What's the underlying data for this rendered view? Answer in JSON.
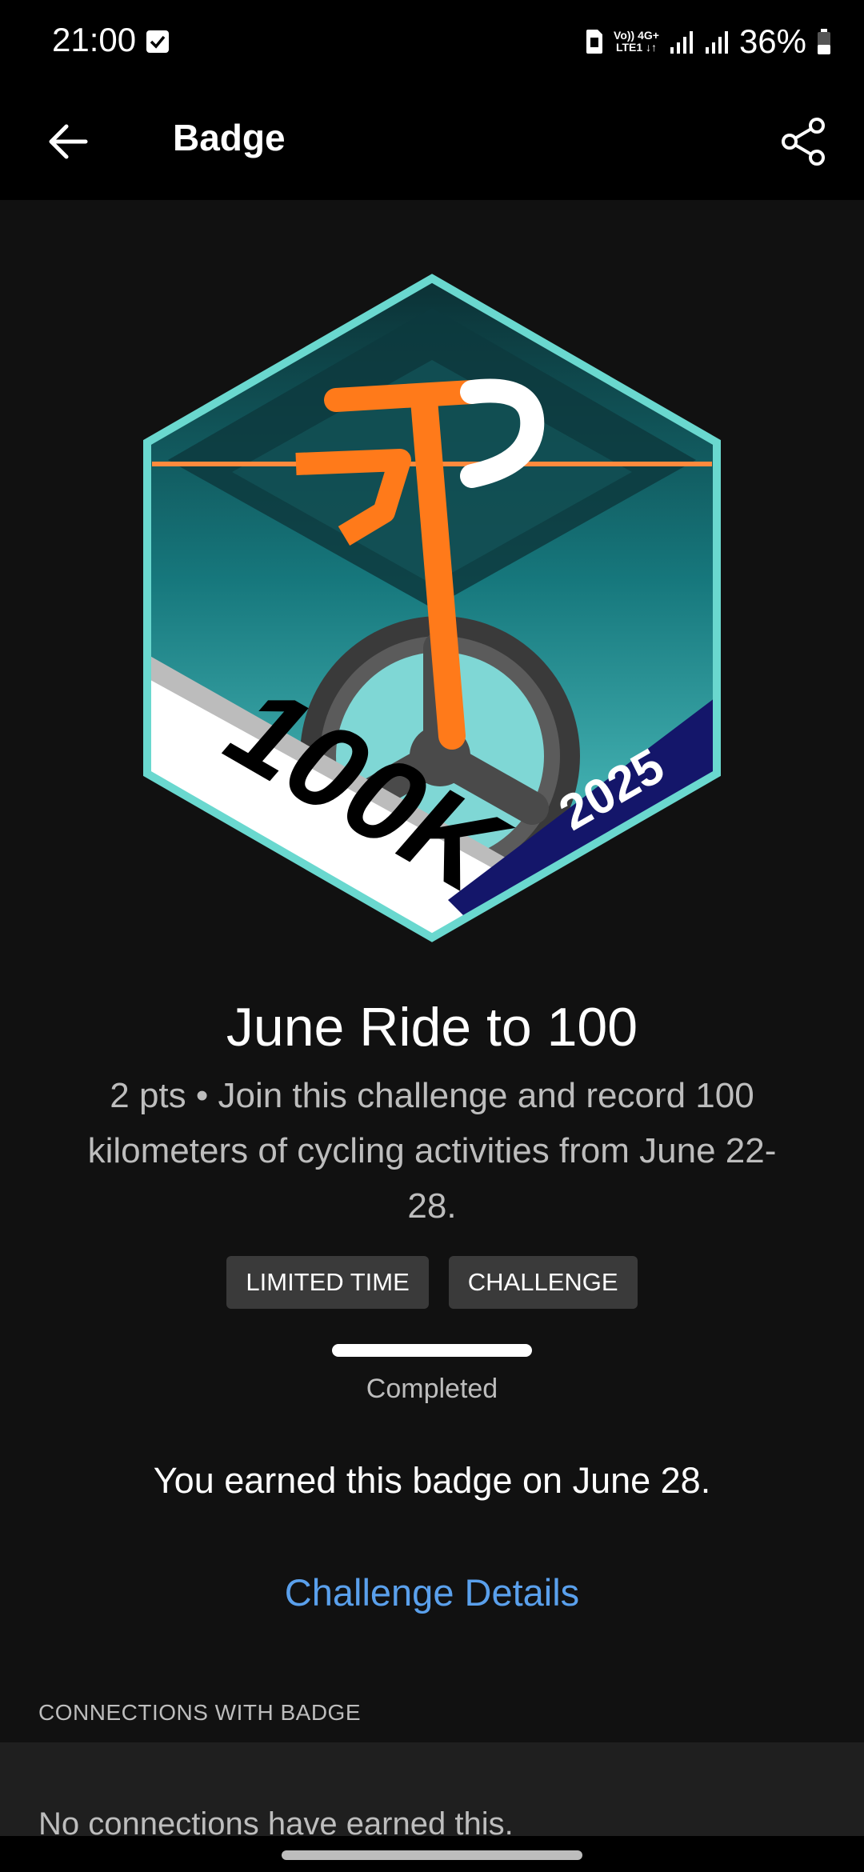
{
  "status_bar": {
    "time": "21:00",
    "network_lines": [
      "Vo)) 4G+",
      "LTE1 ↓↑"
    ],
    "battery_text": "36%"
  },
  "app_bar": {
    "title": "Badge"
  },
  "badge": {
    "art_label": "100K",
    "art_year": "2025",
    "title": "June Ride to 100",
    "description": "2 pts • Join this challenge and record 100 kilometers of cycling activities from June 22-28.",
    "tags": [
      "LIMITED TIME",
      "CHALLENGE"
    ],
    "progress_fraction": 1.0,
    "progress_label": "Completed",
    "earned_text": "You earned this badge on June 28.",
    "challenge_link": "Challenge Details"
  },
  "connections": {
    "header": "CONNECTIONS WITH BADGE",
    "empty_text": "No connections have earned this."
  },
  "colors": {
    "accent_link": "#5aa0ec",
    "badge_teal": "#1e9b9b",
    "badge_orange": "#ff7a1a",
    "badge_navy": "#14166a"
  }
}
